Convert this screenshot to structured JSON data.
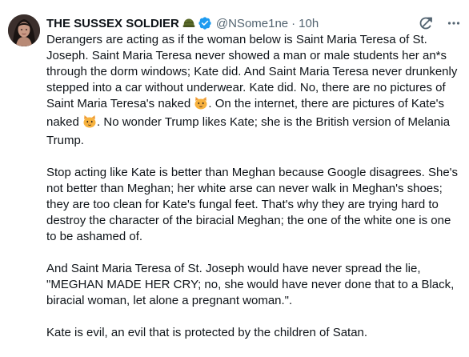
{
  "author": {
    "display_name": "THE SUSSEX SOLDIER",
    "handle": "@NSome1ne",
    "separator": "·",
    "time": "10h",
    "name_emoji_icon": "military-helmet-icon",
    "verified_icon": "verified-badge-icon"
  },
  "header_actions": {
    "grok_icon": "grok-icon",
    "more_icon": "more-horizontal-icon"
  },
  "colors": {
    "text": "#0f1419",
    "muted": "#536471",
    "verified": "#1d9bf0"
  },
  "tweet": {
    "p1": {
      "a": "Derangers are acting as if the woman below is Saint Maria Teresa of St. Joseph. Saint Maria Teresa never showed a man or male students her an*s through the dorm windows; Kate did. And Saint Maria Teresa never drunkenly stepped into a car without underwear. Kate did. No, there are no pictures of Saint Maria Teresa's naked ",
      "b": ". On the internet, there are pictures of Kate's naked ",
      "c": ". No wonder Trump likes Kate; she is the British version of Melania Trump.",
      "emoji_icon": "cat-face-icon"
    },
    "p2": "Stop acting like Kate is better than Meghan because Google disagrees. She's not better than Meghan; her white arse can never walk in Meghan's shoes; they are too clean for Kate's fungal feet. That's why they are trying hard to destroy the character of the biracial Meghan; the one of the white one is one to be ashamed of.",
    "p3": "And Saint Maria Teresa of St. Joseph would have never spread the lie, \"MEGHAN MADE HER CRY; no, she would have never done that to a Black, biracial woman, let alone a pregnant woman.\".",
    "p4": "Kate is evil, an evil that is protected by the children of Satan."
  }
}
